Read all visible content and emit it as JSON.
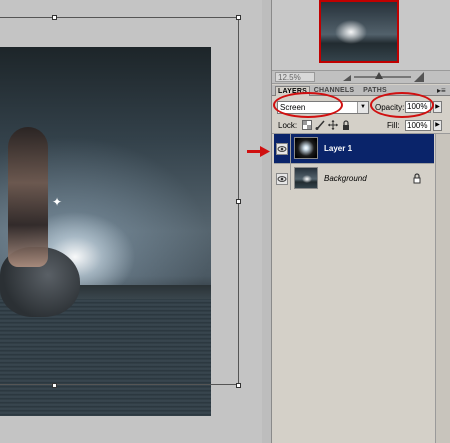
{
  "navigator": {
    "zoom": "12.5%"
  },
  "panel": {
    "tabs": [
      {
        "label": "LAYERS",
        "active": true
      },
      {
        "label": "CHANNELS",
        "active": false
      },
      {
        "label": "PATHS",
        "active": false
      }
    ],
    "blend_mode": "Screen",
    "opacity_label": "Opacity:",
    "opacity_value": "100%",
    "lock_label": "Lock:",
    "fill_label": "Fill:",
    "fill_value": "100%"
  },
  "layers": [
    {
      "name": "Layer 1",
      "visible": true,
      "selected": true
    },
    {
      "name": "Background",
      "visible": true,
      "selected": false,
      "locked": true
    }
  ],
  "colors": {
    "selection": "#0a246a",
    "annotation": "#d01010",
    "panel": "#d4d0c8"
  },
  "icons": [
    "eye-icon",
    "lock-transparency-icon",
    "brush-icon",
    "move-icon",
    "lock-all-icon",
    "lock-icon",
    "red-arrow-icon",
    "panel-menu-icon"
  ]
}
